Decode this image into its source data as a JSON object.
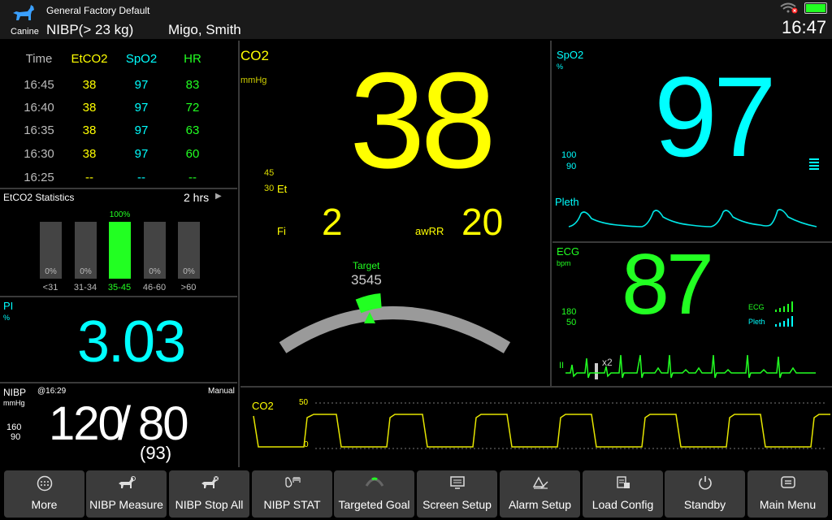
{
  "header": {
    "profile": "General Factory Default",
    "patient_type": "Canine",
    "nibp_mode": "NIBP(> 23 kg)",
    "patient_name": "Migo, Smith",
    "time": "16:47"
  },
  "trend_table": {
    "headers": [
      "Time",
      "EtCO2",
      "SpO2",
      "HR"
    ],
    "rows": [
      [
        "16:45",
        "38",
        "97",
        "83"
      ],
      [
        "16:40",
        "38",
        "97",
        "72"
      ],
      [
        "16:35",
        "38",
        "97",
        "63"
      ],
      [
        "16:30",
        "38",
        "97",
        "60"
      ],
      [
        "16:25",
        "--",
        "--",
        "--"
      ]
    ]
  },
  "etco2_stats": {
    "title": "EtCO2 Statistics",
    "period": "2 hrs",
    "bars": [
      {
        "label": "<31",
        "pct": "0%",
        "value": 0
      },
      {
        "label": "31-34",
        "pct": "0%",
        "value": 0
      },
      {
        "label": "35-45",
        "pct": "100%",
        "value": 100
      },
      {
        "label": "46-60",
        "pct": "0%",
        "value": 0
      },
      {
        "label": ">60",
        "pct": "0%",
        "value": 0
      }
    ]
  },
  "pi": {
    "label": "PI",
    "unit": "%",
    "value": "3.03"
  },
  "nibp": {
    "label": "NIBP",
    "time": "@16:29",
    "mode": "Manual",
    "unit": "mmHg",
    "limit_high": "160",
    "limit_low": "90",
    "systolic": "120",
    "separator": "/",
    "diastolic": "80",
    "mean": "(93)"
  },
  "co2": {
    "label": "CO2",
    "unit": "mmHg",
    "value": "38",
    "limit_high": "45",
    "limit_low": "30",
    "et_label": "Et",
    "fi_label": "Fi",
    "fi_value": "2",
    "awrr_label": "awRR",
    "awrr_value": "20",
    "target_label": "Target",
    "target_value": "3545",
    "gauge_fraction": 0.42
  },
  "spo2": {
    "label": "SpO2",
    "unit": "%",
    "value": "97",
    "limit_high": "100",
    "limit_low": "90"
  },
  "pleth": {
    "label": "Pleth"
  },
  "ecg": {
    "label": "ECG",
    "unit": "bpm",
    "value": "87",
    "limit_high": "180",
    "limit_low": "50",
    "src_ecg": "ECG",
    "src_pleth": "Pleth",
    "lead": "II",
    "gain": "x2"
  },
  "co2_wave": {
    "label": "CO2",
    "scale_high": "50",
    "scale_low": "0"
  },
  "buttons": [
    {
      "label": "More",
      "icon": "more-icon"
    },
    {
      "label": "NIBP Measure",
      "icon": "dog-measure-icon"
    },
    {
      "label": "NIBP Stop All",
      "icon": "dog-stop-icon"
    },
    {
      "label": "NIBP STAT",
      "icon": "stat-icon"
    },
    {
      "label": "Targeted Goal",
      "icon": "gauge-icon"
    },
    {
      "label": "Screen Setup",
      "icon": "screen-icon"
    },
    {
      "label": "Alarm Setup",
      "icon": "alarm-icon"
    },
    {
      "label": "Load Config",
      "icon": "config-icon"
    },
    {
      "label": "Standby",
      "icon": "power-icon"
    },
    {
      "label": "Main Menu",
      "icon": "menu-icon"
    }
  ],
  "colors": {
    "co2": "#ffff00",
    "spo2": "#00ffff",
    "hr": "#22ff22",
    "button_bg": "#3b3b3b"
  }
}
